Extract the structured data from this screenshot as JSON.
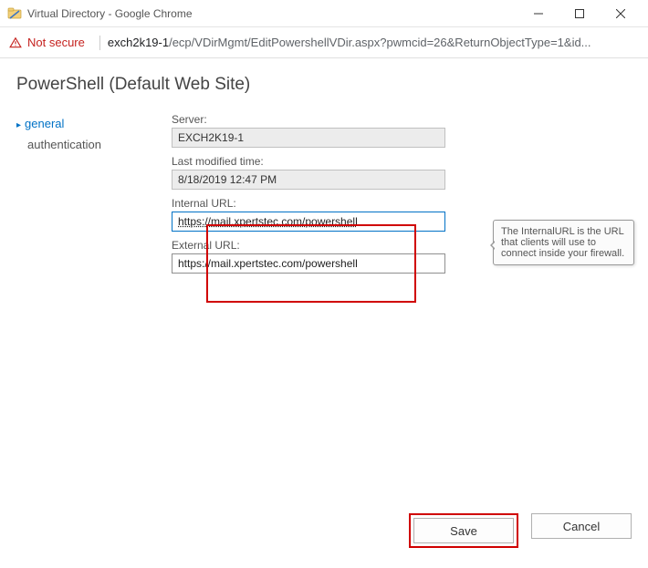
{
  "window": {
    "title": "Virtual Directory - Google Chrome"
  },
  "address": {
    "not_secure": "Not secure",
    "host": "exch2k19-1",
    "path": "/ecp/VDirMgmt/EditPowershellVDir.aspx?pwmcid=26&ReturnObjectType=1&id..."
  },
  "header": {
    "title": "PowerShell (Default Web Site)"
  },
  "sidebar": {
    "items": [
      "general",
      "authentication"
    ],
    "active_index": 0
  },
  "fields": {
    "server_label": "Server:",
    "server_value": "EXCH2K19-1",
    "modified_label": "Last modified time:",
    "modified_value": "8/18/2019 12:47 PM",
    "internal_label": "Internal URL:",
    "internal_value": "https://mail.xpertstec.com/powershell",
    "external_label": "External URL:",
    "external_value": "https://mail.xpertstec.com/powershell"
  },
  "tooltip": {
    "text": "The InternalURL is the URL that clients will use to connect inside your firewall."
  },
  "footer": {
    "save": "Save",
    "cancel": "Cancel"
  }
}
